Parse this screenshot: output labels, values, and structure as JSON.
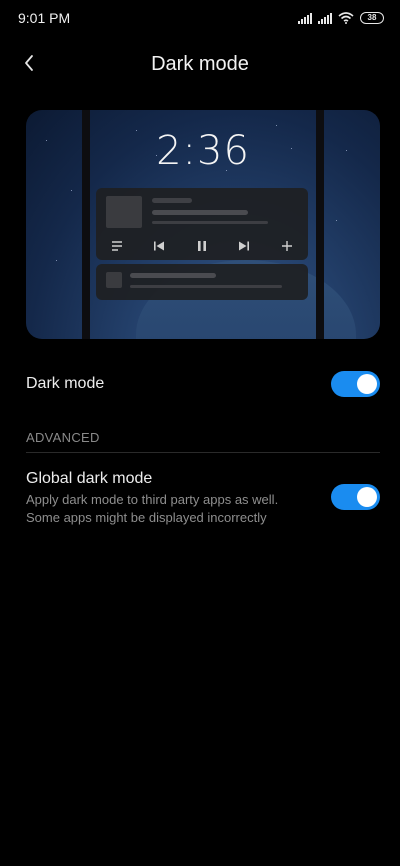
{
  "status_bar": {
    "time": "9:01 PM",
    "battery_level": "38"
  },
  "header": {
    "title": "Dark mode",
    "back_icon": "chevron-left-icon"
  },
  "preview": {
    "clock": "2:36"
  },
  "settings": {
    "dark_mode": {
      "label": "Dark mode",
      "enabled": true
    },
    "advanced_header": "ADVANCED",
    "global_dark_mode": {
      "label": "Global dark mode",
      "description_line1": "Apply dark mode to third party apps as well.",
      "description_line2": "Some apps might be displayed incorrectly",
      "enabled": true
    }
  },
  "colors": {
    "accent": "#1a8cf0",
    "background": "#000000"
  }
}
